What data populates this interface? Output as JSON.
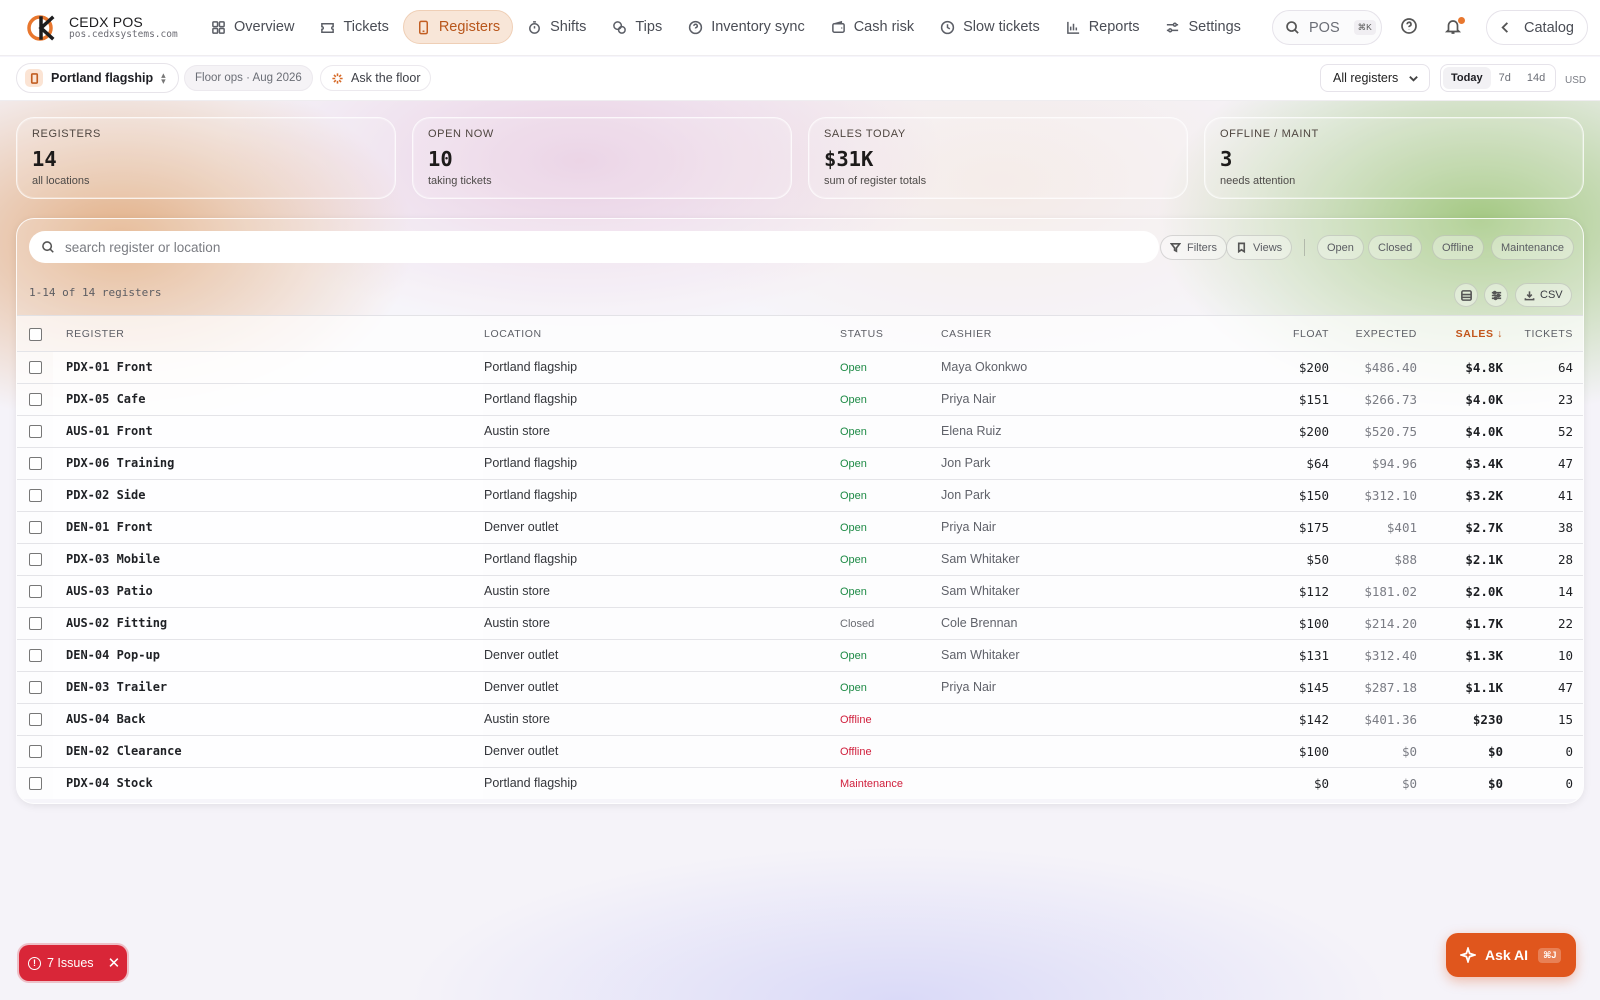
{
  "brand": {
    "name": "CEDX POS",
    "url": "pos.cedxsystems.com"
  },
  "nav": {
    "items": [
      {
        "label": "Overview",
        "icon": "grid-icon"
      },
      {
        "label": "Tickets",
        "icon": "ticket-icon"
      },
      {
        "label": "Registers",
        "icon": "register-icon",
        "active": true
      },
      {
        "label": "Shifts",
        "icon": "stopwatch-icon"
      },
      {
        "label": "Tips",
        "icon": "coins-icon"
      },
      {
        "label": "Inventory sync",
        "icon": "help-circle-icon"
      },
      {
        "label": "Cash risk",
        "icon": "wallet-icon"
      },
      {
        "label": "Slow tickets",
        "icon": "clock-icon"
      },
      {
        "label": "Reports",
        "icon": "bar-chart-icon"
      },
      {
        "label": "Settings",
        "icon": "sliders-icon"
      }
    ],
    "search_label": "POS",
    "search_kbd": "⌘K",
    "catalog_label": "Catalog"
  },
  "subbar": {
    "location": "Portland flagship",
    "floor_pill": "Floor ops · Aug 2026",
    "ask_floor": "Ask the floor",
    "registers_filter": "All registers",
    "ranges": [
      "Today",
      "7d",
      "14d"
    ],
    "active_range": "Today",
    "currency": "USD"
  },
  "stats": [
    {
      "label": "REGISTERS",
      "value": "14",
      "sub": "all locations"
    },
    {
      "label": "OPEN NOW",
      "value": "10",
      "sub": "taking tickets"
    },
    {
      "label": "SALES TODAY",
      "value": "$31K",
      "sub": "sum of register totals"
    },
    {
      "label": "OFFLINE / MAINT",
      "value": "3",
      "sub": "needs attention"
    }
  ],
  "table": {
    "search_placeholder": "search register or location",
    "filters_label": "Filters",
    "views_label": "Views",
    "status_chips": [
      "Open",
      "Closed",
      "Offline",
      "Maintenance"
    ],
    "count_label": "1-14 of 14 registers",
    "csv_label": "CSV",
    "columns": {
      "register": "REGISTER",
      "location": "LOCATION",
      "status": "STATUS",
      "cashier": "CASHIER",
      "float": "FLOAT",
      "expected": "EXPECTED",
      "sales": "SALES ↓",
      "tickets": "TICKETS"
    },
    "rows": [
      {
        "register": "PDX-01 Front",
        "location": "Portland flagship",
        "status": "Open",
        "cashier": "Maya Okonkwo",
        "float": "$200",
        "expected": "$486.40",
        "sales": "$4.8K",
        "tickets": "64"
      },
      {
        "register": "PDX-05 Cafe",
        "location": "Portland flagship",
        "status": "Open",
        "cashier": "Priya Nair",
        "float": "$151",
        "expected": "$266.73",
        "sales": "$4.0K",
        "tickets": "23"
      },
      {
        "register": "AUS-01 Front",
        "location": "Austin store",
        "status": "Open",
        "cashier": "Elena Ruiz",
        "float": "$200",
        "expected": "$520.75",
        "sales": "$4.0K",
        "tickets": "52"
      },
      {
        "register": "PDX-06 Training",
        "location": "Portland flagship",
        "status": "Open",
        "cashier": "Jon Park",
        "float": "$64",
        "expected": "$94.96",
        "sales": "$3.4K",
        "tickets": "47"
      },
      {
        "register": "PDX-02 Side",
        "location": "Portland flagship",
        "status": "Open",
        "cashier": "Jon Park",
        "float": "$150",
        "expected": "$312.10",
        "sales": "$3.2K",
        "tickets": "41"
      },
      {
        "register": "DEN-01 Front",
        "location": "Denver outlet",
        "status": "Open",
        "cashier": "Priya Nair",
        "float": "$175",
        "expected": "$401",
        "sales": "$2.7K",
        "tickets": "38"
      },
      {
        "register": "PDX-03 Mobile",
        "location": "Portland flagship",
        "status": "Open",
        "cashier": "Sam Whitaker",
        "float": "$50",
        "expected": "$88",
        "sales": "$2.1K",
        "tickets": "28"
      },
      {
        "register": "AUS-03 Patio",
        "location": "Austin store",
        "status": "Open",
        "cashier": "Sam Whitaker",
        "float": "$112",
        "expected": "$181.02",
        "sales": "$2.0K",
        "tickets": "14"
      },
      {
        "register": "AUS-02 Fitting",
        "location": "Austin store",
        "status": "Closed",
        "cashier": "Cole Brennan",
        "float": "$100",
        "expected": "$214.20",
        "sales": "$1.7K",
        "tickets": "22"
      },
      {
        "register": "DEN-04 Pop-up",
        "location": "Denver outlet",
        "status": "Open",
        "cashier": "Sam Whitaker",
        "float": "$131",
        "expected": "$312.40",
        "sales": "$1.3K",
        "tickets": "10"
      },
      {
        "register": "DEN-03 Trailer",
        "location": "Denver outlet",
        "status": "Open",
        "cashier": "Priya Nair",
        "float": "$145",
        "expected": "$287.18",
        "sales": "$1.1K",
        "tickets": "47"
      },
      {
        "register": "AUS-04 Back",
        "location": "Austin store",
        "status": "Offline",
        "cashier": "",
        "float": "$142",
        "expected": "$401.36",
        "sales": "$230",
        "tickets": "15"
      },
      {
        "register": "DEN-02 Clearance",
        "location": "Denver outlet",
        "status": "Offline",
        "cashier": "",
        "float": "$100",
        "expected": "$0",
        "sales": "$0",
        "tickets": "0"
      },
      {
        "register": "PDX-04 Stock",
        "location": "Portland flagship",
        "status": "Maintenance",
        "cashier": "",
        "float": "$0",
        "expected": "$0",
        "sales": "$0",
        "tickets": "0"
      }
    ]
  },
  "issues": {
    "label": "7 Issues"
  },
  "ask_ai": {
    "label": "Ask AI",
    "kbd": "⌘J"
  },
  "colors": {
    "accent": "#e0561d",
    "open": "#1d8a45",
    "offline": "#d01f3c",
    "issues": "#d92638"
  }
}
